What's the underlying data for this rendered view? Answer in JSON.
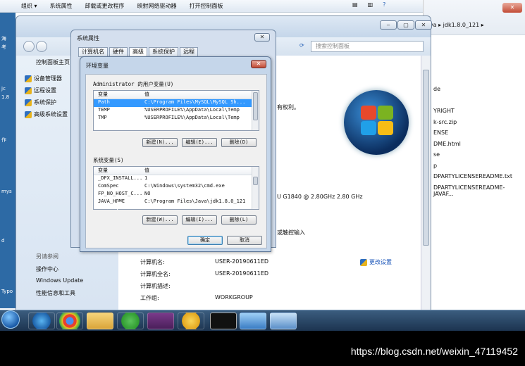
{
  "explorer": {
    "toolbar": [
      "组织 ▾",
      "系统属性",
      "卸载或更改程序",
      "映射网络驱动器",
      "打开控制面板"
    ],
    "breadcrumb_suffix": "ava ▸ jdk1.8.0_121 ▸",
    "file_list": [
      "de",
      "",
      "YRIGHT",
      "k-src.zip",
      "ENSE",
      "DME.html",
      "se",
      "p",
      "DPARTYLICENSEREADME.txt",
      "DPARTYLICENSEREADME-JAVAF..."
    ]
  },
  "desktop_left": [
    "海",
    "考",
    "jc",
    "1.8",
    "作",
    "mys",
    "d",
    "Typo"
  ],
  "control_panel": {
    "search_placeholder": "搜索控制面板",
    "home": "控制面板主页",
    "nav": [
      {
        "label": "设备管理器",
        "icon": "shield-icon"
      },
      {
        "label": "远程设置",
        "icon": "shield-icon"
      },
      {
        "label": "系统保护",
        "icon": "shield-icon"
      },
      {
        "label": "高级系统设置",
        "icon": "shield-icon"
      }
    ],
    "see_also": "另请参阅",
    "see_also_items": [
      "操作中心",
      "Windows Update",
      "性能信息和工具"
    ],
    "rights_fragment": "有权利。",
    "cpu_fragment": "U G1840 @ 2.80GHz   2.80 GHz",
    "touch_fragment": "或触控输入",
    "info": [
      {
        "label": "计算机名:",
        "value": "USER-20190611ED"
      },
      {
        "label": "计算机全名:",
        "value": "USER-20190611ED"
      },
      {
        "label": "计算机描述:",
        "value": ""
      },
      {
        "label": "工作组:",
        "value": "WORKGROUP"
      }
    ],
    "change_settings": "更改设置"
  },
  "sys_props": {
    "title": "系统属性",
    "tabs": [
      "计算机名",
      "硬件",
      "高级",
      "系统保护",
      "远程"
    ],
    "active_tab": "高级"
  },
  "env_dialog": {
    "title": "环境变量",
    "user_group": "Administrator 的用户变量(U)",
    "col_var": "变量",
    "col_val": "值",
    "user_vars": [
      {
        "name": "Path",
        "value": "C:\\Program Files\\MySQL\\MySQL Sh...",
        "selected": true
      },
      {
        "name": "TEMP",
        "value": "%USERPROFILE%\\AppData\\Local\\Temp",
        "selected": false
      },
      {
        "name": "TMP",
        "value": "%USERPROFILE%\\AppData\\Local\\Temp",
        "selected": false
      }
    ],
    "user_buttons": [
      "新建(N)...",
      "编辑(E)...",
      "删除(D)"
    ],
    "sys_group": "系统变量(S)",
    "sys_vars": [
      {
        "name": "_DFX_INSTALL...",
        "value": "1"
      },
      {
        "name": "ComSpec",
        "value": "C:\\Windows\\system32\\cmd.exe"
      },
      {
        "name": "FP_NO_HOST_C...",
        "value": "NO"
      },
      {
        "name": "JAVA_HOME",
        "value": "C:\\Program Files\\Java\\jdk1.8.0_121"
      }
    ],
    "sys_buttons": [
      "新建(W)...",
      "编辑(I)...",
      "删除(L)"
    ],
    "ok": "确定",
    "cancel": "取消"
  },
  "watermark": "https://blog.csdn.net/weixin_47119452"
}
